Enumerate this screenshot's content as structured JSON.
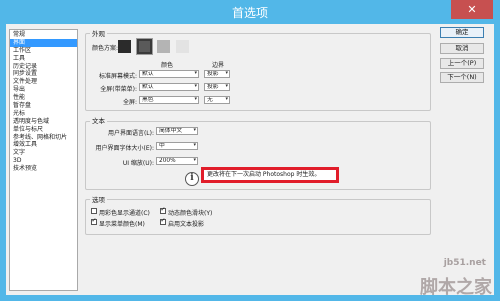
{
  "window": {
    "title": "首选项",
    "close_label": "✕"
  },
  "sidebar": {
    "items": [
      {
        "label": "常规",
        "selected": false
      },
      {
        "label": "界面",
        "selected": true
      },
      {
        "label": "工作区",
        "selected": false
      },
      {
        "label": "工具",
        "selected": false
      },
      {
        "label": "历史记录",
        "selected": false
      },
      {
        "label": "同步设置",
        "selected": false
      },
      {
        "label": "文件处理",
        "selected": false
      },
      {
        "label": "导出",
        "selected": false
      },
      {
        "label": "性能",
        "selected": false
      },
      {
        "label": "暂存盘",
        "selected": false
      },
      {
        "label": "光标",
        "selected": false
      },
      {
        "label": "透明度与色域",
        "selected": false
      },
      {
        "label": "单位与标尺",
        "selected": false
      },
      {
        "label": "参考线、网格和切片",
        "selected": false
      },
      {
        "label": "增效工具",
        "selected": false
      },
      {
        "label": "文字",
        "selected": false
      },
      {
        "label": "3D",
        "selected": false
      },
      {
        "label": "技术预览",
        "selected": false
      }
    ]
  },
  "appearance": {
    "title": "外观",
    "color_scheme_label": "颜色方案:",
    "swatches": [
      "#2b2b2b",
      "#5a5a5a",
      "#b4b4b4",
      "#e3e3e3"
    ],
    "col_color": "颜色",
    "col_border": "边界",
    "rows": [
      {
        "label": "标准屏幕模式:",
        "color": "默认",
        "border": "投影"
      },
      {
        "label": "全屏(带菜单):",
        "color": "默认",
        "border": "投影"
      },
      {
        "label": "全屏:",
        "color": "黑色",
        "border": "无"
      }
    ]
  },
  "text": {
    "title": "文本",
    "ui_language_label": "用户界面语言(L):",
    "ui_language_value": "简体中文",
    "ui_font_size_label": "用户界面字体大小(E):",
    "ui_font_size_value": "中",
    "ui_scale_label": "UI 缩放(U):",
    "ui_scale_value": "200%",
    "notice": "更改将在下一次启动 Photoshop 时生效。"
  },
  "options": {
    "title": "选项",
    "checkboxes": [
      {
        "label": "用彩色显示通道(C)",
        "checked": false
      },
      {
        "label": "动态颜色滑块(Y)",
        "checked": true
      },
      {
        "label": "显示菜单颜色(M)",
        "checked": true
      },
      {
        "label": "启用文本投影",
        "checked": true
      }
    ]
  },
  "buttons": {
    "ok": "确定",
    "cancel": "取消",
    "prev": "上一个(P)",
    "next": "下一个(N)"
  },
  "watermark": {
    "site": "jb51.net",
    "brand": "脚本之家"
  },
  "colors": {
    "titlebar": "#52b7e8",
    "close": "#c75050",
    "selected": "#3399ff",
    "notice_border": "#e11d2a"
  }
}
